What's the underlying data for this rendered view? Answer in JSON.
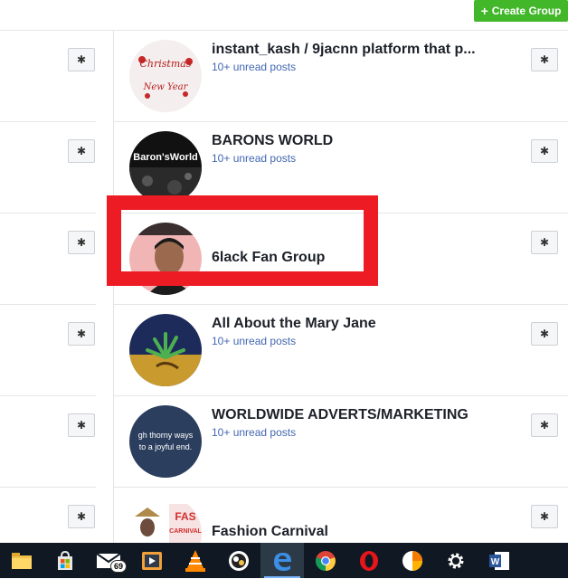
{
  "header": {
    "create_group_label": "Create Group"
  },
  "groups": [
    {
      "name": "instant_kash / 9jacnn platform that p...",
      "subtitle": "10+ unread posts",
      "avatar_text": "Christmas / New Year"
    },
    {
      "name": "BARONS WORLD",
      "subtitle": "10+ unread posts",
      "avatar_text": "Baron'sWorld"
    },
    {
      "name": "6lack Fan Group",
      "subtitle": "",
      "avatar_text": ""
    },
    {
      "name": "All About the Mary Jane",
      "subtitle": "10+ unread posts",
      "avatar_text": ""
    },
    {
      "name": "WORLDWIDE ADVERTS/MARKETING",
      "subtitle": "10+ unread posts",
      "avatar_text": "gh thorny ways to a joyful end."
    },
    {
      "name": "Fashion Carnival",
      "subtitle": "",
      "avatar_text": "FASHION CARNIVAL"
    }
  ],
  "settings_glyph": "✱",
  "taskbar": {
    "mail_badge": "69",
    "apps": [
      "file-explorer-icon",
      "store-icon",
      "mail-icon",
      "media-player-icon",
      "vlc-icon",
      "fruit-app-icon",
      "edge-icon",
      "chrome-icon",
      "opera-icon",
      "pie-chart-app-icon",
      "settings-icon",
      "word-icon"
    ]
  },
  "colors": {
    "accent_green": "#42b72a",
    "link_blue": "#4267b2",
    "highlight_red": "#ed1c24",
    "taskbar_bg": "#101923"
  }
}
